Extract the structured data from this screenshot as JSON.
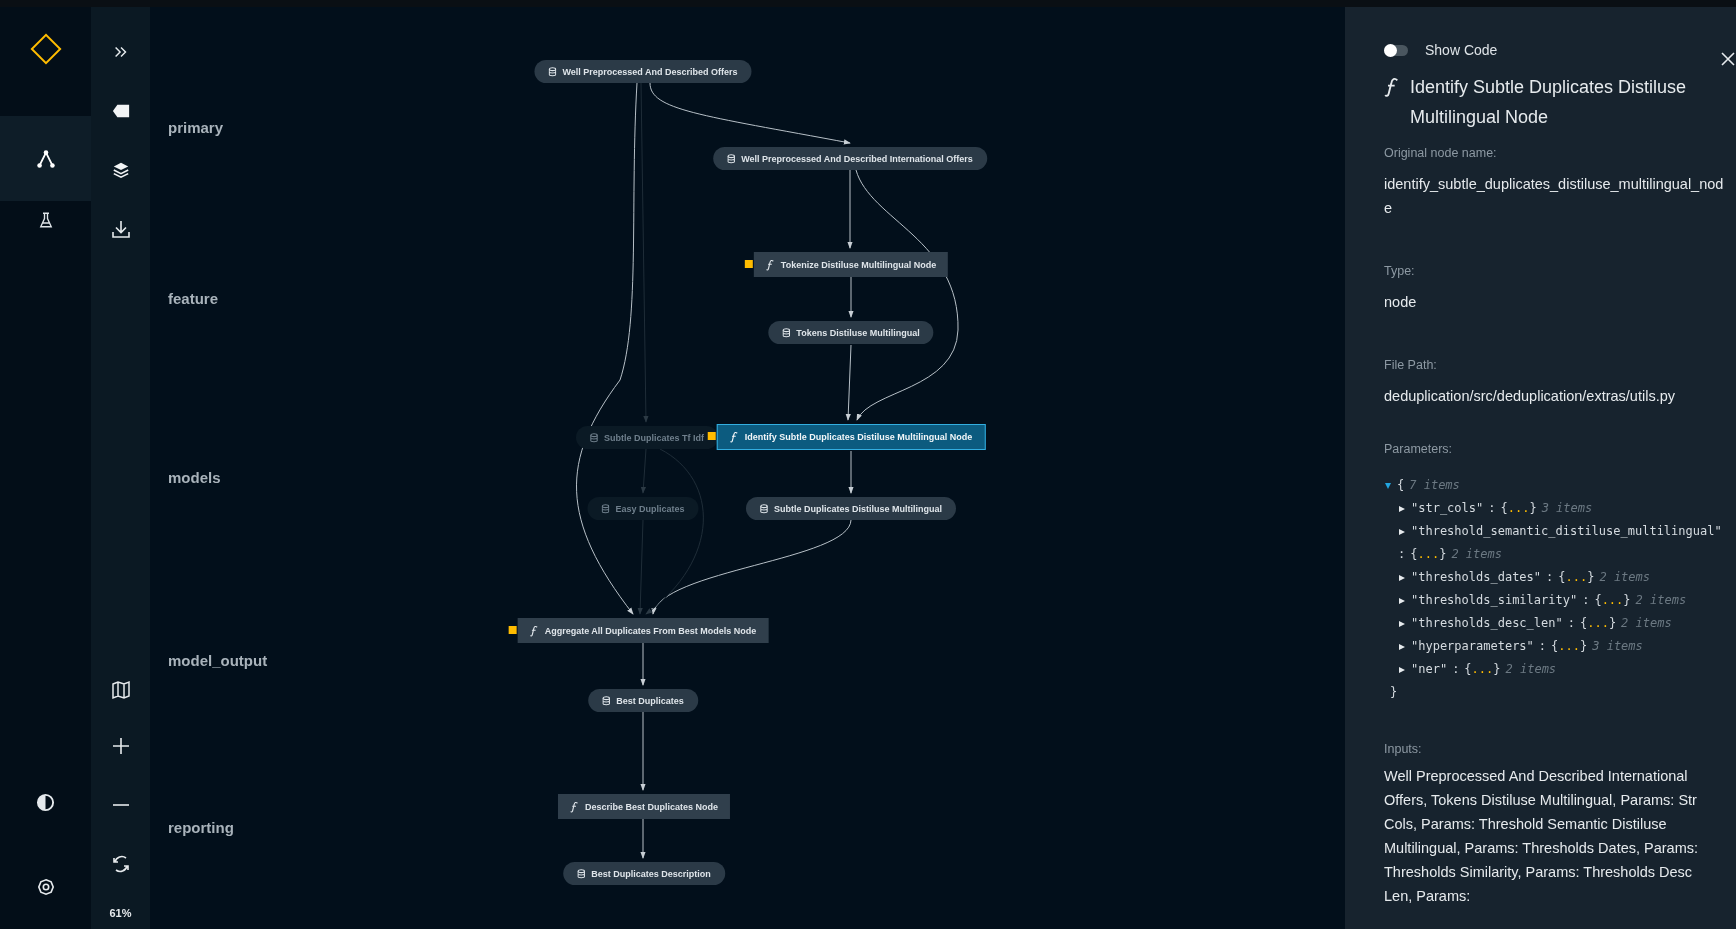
{
  "sidebar": {
    "nav": [
      {
        "kind": "pipeline",
        "selected": true
      },
      {
        "kind": "experiments",
        "selected": false
      }
    ]
  },
  "toolbar": {
    "zoom": "61%"
  },
  "graph": {
    "layers": [
      "primary",
      "feature",
      "models",
      "model_output",
      "reporting"
    ],
    "nodes": [
      {
        "label": "Well Preprocessed And Described Offers",
        "kind": "dataset",
        "selected": false,
        "faded": false,
        "has_parameters": false
      },
      {
        "label": "Well Preprocessed And Described International Offers",
        "kind": "dataset",
        "selected": false,
        "faded": false,
        "has_parameters": false
      },
      {
        "label": "Tokenize Distiluse Multilingual Node",
        "kind": "task",
        "selected": false,
        "faded": false,
        "has_parameters": true
      },
      {
        "label": "Tokens Distiluse Multilingual",
        "kind": "dataset",
        "selected": false,
        "faded": false,
        "has_parameters": false
      },
      {
        "label": "Subtle Duplicates Tf Idf",
        "kind": "dataset",
        "selected": false,
        "faded": true,
        "has_parameters": false
      },
      {
        "label": "Identify Subtle Duplicates Distiluse Multilingual Node",
        "kind": "task",
        "selected": true,
        "faded": false,
        "has_parameters": true
      },
      {
        "label": "Easy Duplicates",
        "kind": "dataset",
        "selected": false,
        "faded": true,
        "has_parameters": false
      },
      {
        "label": "Subtle Duplicates Distiluse Multilingual",
        "kind": "dataset",
        "selected": false,
        "faded": false,
        "has_parameters": false
      },
      {
        "label": "Aggregate All Duplicates From Best Models Node",
        "kind": "task",
        "selected": false,
        "faded": false,
        "has_parameters": true
      },
      {
        "label": "Best Duplicates",
        "kind": "dataset",
        "selected": false,
        "faded": false,
        "has_parameters": false
      },
      {
        "label": "Describe Best Duplicates Node",
        "kind": "task",
        "selected": false,
        "faded": false,
        "has_parameters": false
      },
      {
        "label": "Best Duplicates Description",
        "kind": "dataset",
        "selected": false,
        "faded": false,
        "has_parameters": false
      }
    ]
  },
  "details": {
    "show_code": {
      "label": "Show Code",
      "on": false
    },
    "title": "Identify Subtle Duplicates Distiluse Multilingual Node",
    "fields": [
      {
        "label": "Original node name:",
        "value": "identify_subtle_duplicates_distiluse_multilingual_node"
      },
      {
        "label": "Type:",
        "value": "node"
      },
      {
        "label": "File Path:",
        "value": "deduplication/src/deduplication/extras/utils.py"
      }
    ],
    "parameters": {
      "label": "Parameters:",
      "root": {
        "open": "{",
        "count": "7 items",
        "close": "}",
        "expanded": true
      },
      "entries": [
        {
          "key": "\"str_cols\"",
          "colon": ":",
          "open": "{",
          "dots": "...",
          "close": "}",
          "count": "3 items",
          "expanded": false
        },
        {
          "key": "\"threshold_semantic_distiluse_multilingual\"",
          "colon": ":",
          "open": "{",
          "dots": "...",
          "close": "}",
          "count": "2 items",
          "expanded": false
        },
        {
          "key": "\"thresholds_dates\"",
          "colon": ":",
          "open": "{",
          "dots": "...",
          "close": "}",
          "count": "2 items",
          "expanded": false
        },
        {
          "key": "\"thresholds_similarity\"",
          "colon": ":",
          "open": "{",
          "dots": "...",
          "close": "}",
          "count": "2 items",
          "expanded": false
        },
        {
          "key": "\"thresholds_desc_len\"",
          "colon": ":",
          "open": "{",
          "dots": "...",
          "close": "}",
          "count": "2 items",
          "expanded": false
        },
        {
          "key": "\"hyperparameters\"",
          "colon": ":",
          "open": "{",
          "dots": "...",
          "close": "}",
          "count": "3 items",
          "expanded": false
        },
        {
          "key": "\"ner\"",
          "colon": ":",
          "open": "{",
          "dots": "...",
          "close": "}",
          "count": "2 items",
          "expanded": false
        }
      ]
    },
    "inputs": {
      "label": "Inputs:",
      "value": "Well Preprocessed And Described International Offers, Tokens Distiluse Multilingual, Params: Str Cols, Params: Threshold Semantic Distiluse Multilingual, Params: Thresholds Dates, Params: Thresholds Similarity, Params: Thresholds Desc Len, Params:"
    }
  }
}
